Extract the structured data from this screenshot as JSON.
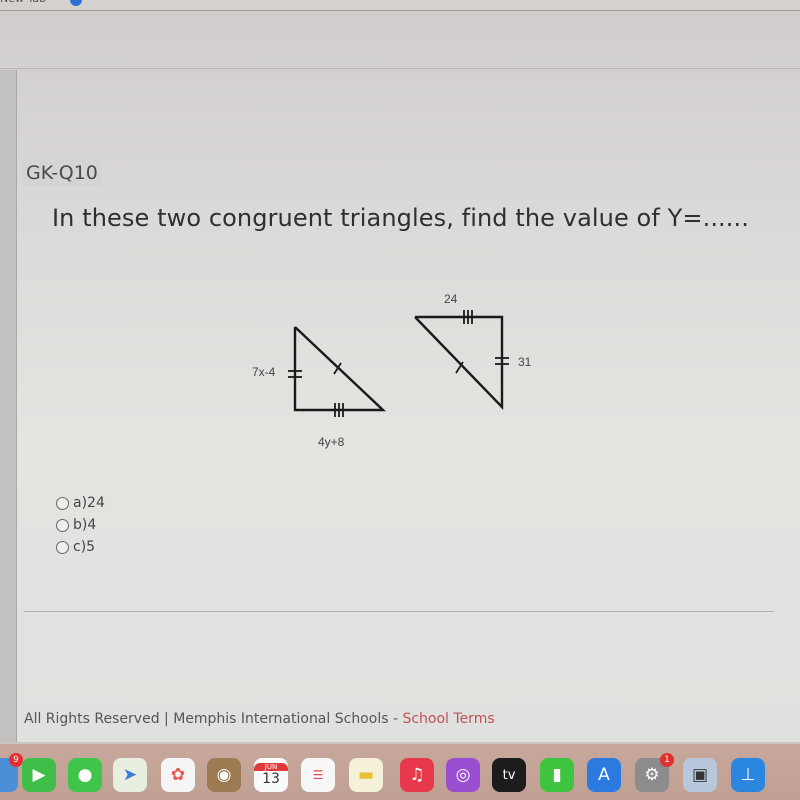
{
  "browser": {
    "tab_label": "New Tab"
  },
  "question": {
    "id": "GK-Q10",
    "text": "In these two congruent triangles, find the value of Y=......"
  },
  "figure": {
    "triangle_left": {
      "left_side_label": "7x-4",
      "bottom_side_label": "4y+8"
    },
    "triangle_right": {
      "top_side_label": "24",
      "right_side_label": "31"
    }
  },
  "options": [
    {
      "label": "a)24",
      "selected": false
    },
    {
      "label": "b)4",
      "selected": false
    },
    {
      "label": "c)5",
      "selected": false
    }
  ],
  "footer": {
    "rights": "All Rights Reserved",
    "separator": "|",
    "org": "Memphis International Schools -",
    "terms_link": "School Terms",
    "terms_color": "#c0505a"
  },
  "dock": {
    "calendar_month": "JUN",
    "calendar_day": "13",
    "tv_label": "tv",
    "settings_badge": "1",
    "left_badge": "9",
    "apps": [
      "finder",
      "facetime",
      "messages",
      "maps",
      "photos",
      "contacts",
      "calendar",
      "reminders",
      "notes",
      "music",
      "podcasts",
      "tv",
      "numbers",
      "app-store",
      "system-preferences",
      "preview",
      "keynote"
    ]
  }
}
